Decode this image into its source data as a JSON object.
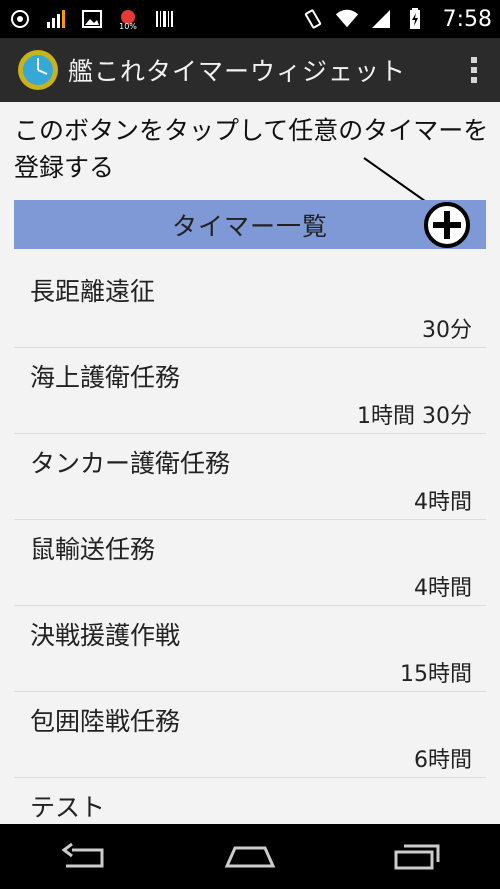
{
  "status_bar": {
    "time": "7:58",
    "battery_percent_label": "10%"
  },
  "action_bar": {
    "title": "艦これタイマーウィジェット"
  },
  "hint": {
    "text": "このボタンをタップして任意のタイマーを登録する"
  },
  "section": {
    "title": "タイマー一覧"
  },
  "timers": [
    {
      "name": "長距離遠征",
      "duration": "30分"
    },
    {
      "name": "海上護衛任務",
      "duration": "1時間 30分"
    },
    {
      "name": "タンカー護衛任務",
      "duration": "4時間"
    },
    {
      "name": "鼠輸送任務",
      "duration": "4時間"
    },
    {
      "name": "決戦援護作戦",
      "duration": "15時間"
    },
    {
      "name": "包囲陸戦任務",
      "duration": "6時間"
    },
    {
      "name": "テスト",
      "duration": ""
    }
  ],
  "colors": {
    "section_header": "#7f98d6",
    "action_bar": "#2b2b2b",
    "background": "#f3f3f3"
  }
}
